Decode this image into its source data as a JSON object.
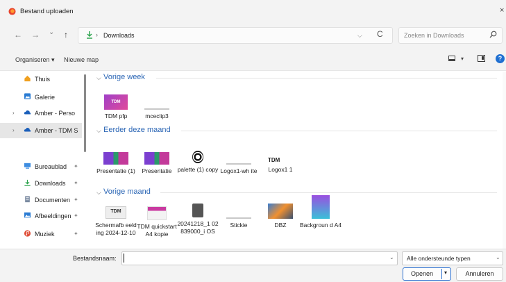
{
  "window": {
    "title": "Bestand uploaden",
    "close": "×"
  },
  "nav": {
    "back": "←",
    "forward": "→",
    "recent": "⌄",
    "up": "↑",
    "address": {
      "separator": "›",
      "folder": "Downloads"
    },
    "refresh": "C",
    "search_placeholder": "Zoeken in Downloads"
  },
  "commandbar": {
    "organize": "Organiseren ▾",
    "new_folder": "Nieuwe map",
    "view_drop": "▾",
    "help": "?"
  },
  "sidebar": {
    "items": [
      {
        "label": "Thuis",
        "icon": "home-icon",
        "color": "#f0a020"
      },
      {
        "label": "Galerie",
        "icon": "gallery-icon",
        "color": "#2b7cd3"
      },
      {
        "label": "Amber - Perso",
        "icon": "cloud-icon",
        "color": "#1b5fba",
        "chevron": "›"
      },
      {
        "label": "Amber - TDM S",
        "icon": "cloud-icon",
        "color": "#1b5fba",
        "chevron": "›"
      },
      {
        "label": "Bureaublad",
        "icon": "desktop-icon",
        "color": "#3d8ce0",
        "pin": "✦"
      },
      {
        "label": "Downloads",
        "icon": "download-icon",
        "color": "#2ea44f",
        "pin": "✦"
      },
      {
        "label": "Documenten",
        "icon": "documents-icon",
        "color": "#7a8aa0",
        "pin": "✦"
      },
      {
        "label": "Afbeeldingen",
        "icon": "pictures-icon",
        "color": "#2b7cd3",
        "pin": "✦"
      },
      {
        "label": "Muziek",
        "icon": "music-icon",
        "color": "#e0503a",
        "pin": "✦"
      }
    ]
  },
  "groups": [
    {
      "title": "Vorige week",
      "files": [
        "TDM pfp",
        "mceclip3"
      ]
    },
    {
      "title": "Eerder deze maand",
      "files": [
        "Presentatie (1)",
        "Presentatie",
        "palette (1) copy",
        "Logox1-wh ite",
        "Logox1 1"
      ]
    },
    {
      "title": "Vorige maand",
      "files": [
        "Schermafb eelding 2024-12-10",
        "TDM quickstart A4 kopie",
        "20241218_1 02839000_i OS",
        "Stickie",
        "DBZ",
        "Backgroun d A4"
      ]
    }
  ],
  "thumbs": {
    "tdm": "TDM",
    "chevron": "⌵"
  },
  "footer": {
    "filename_label": "Bestandsnaam:",
    "filename_value": "",
    "dropdown": "⌄",
    "filetype": "Alle ondersteunde typen",
    "open": "Openen",
    "open_drop": "▾",
    "cancel": "Annuleren"
  },
  "colors": {
    "accent": "#2b66b5",
    "brand": "#e8442e"
  }
}
